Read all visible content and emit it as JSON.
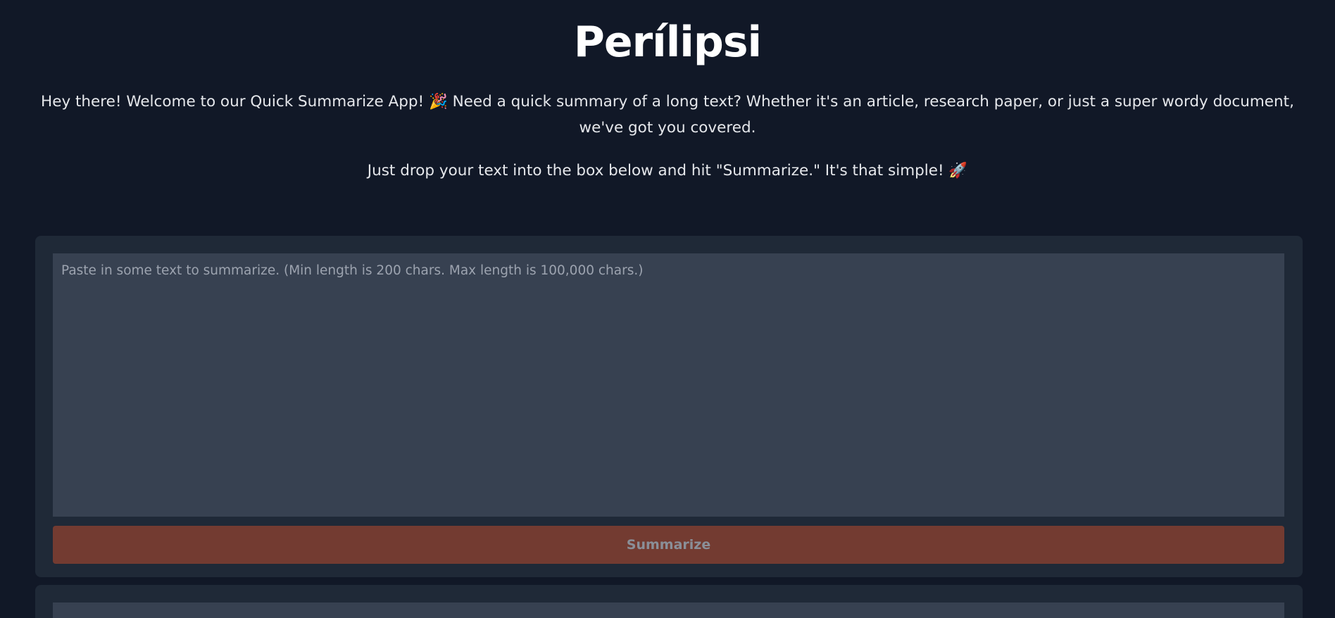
{
  "header": {
    "title": "Perílipsi",
    "intro_line1": "Hey there! Welcome to our Quick Summarize App! 🎉 Need a quick summary of a long text? Whether it's an article, research paper, or just a super wordy document, we've got you covered.",
    "intro_line2": "Just drop your text into the box below and hit \"Summarize.\" It's that simple! 🚀"
  },
  "input_card": {
    "textarea_value": "",
    "textarea_placeholder": "Paste in some text to summarize. (Min length is 200 chars. Max length is 100,000 chars.)",
    "button_label": "Summarize"
  },
  "output_card": {
    "value": ""
  },
  "colors": {
    "background": "#111827",
    "card": "#1f2937",
    "input": "#374151",
    "button": "#733b31",
    "button_text_disabled": "#8a8f98"
  }
}
